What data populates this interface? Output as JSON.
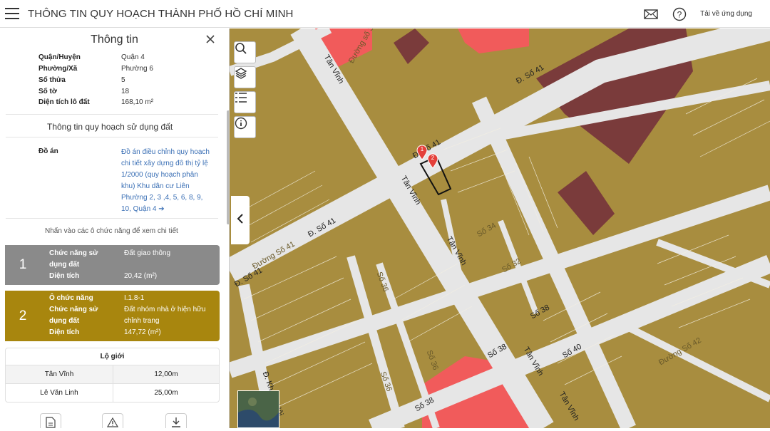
{
  "app": {
    "title": "THÔNG TIN QUY HOẠCH THÀNH PHỐ HỒ CHÍ MINH",
    "download_label": "Tải về ứng dụng"
  },
  "panel": {
    "title": "Thông tin",
    "parcel": [
      {
        "key": "Quận/Huyện",
        "value": "Quận 4"
      },
      {
        "key": "Phường/Xã",
        "value": "Phường 6"
      },
      {
        "key": "Số thửa",
        "value": "5"
      },
      {
        "key": "Số tờ",
        "value": "18"
      },
      {
        "key": "Diện tích lô đất",
        "value": "168,10 m²"
      }
    ],
    "section_title": "Thông tin quy hoạch sử dụng đất",
    "doan": {
      "key": "Đồ án",
      "value": "Đồ án điều chỉnh quy hoạch chi tiết xây dựng đô thị tỷ lệ 1/2000 (quy hoạch phân khu) Khu dân cư Liên Phường 2, 3 ,4, 5, 6, 8, 9, 10, Quận 4 ➔"
    },
    "hint": "Nhấn vào các ô chức năng để xem chi tiết",
    "cards": [
      {
        "number": "1",
        "color": "#8a8a8a",
        "rows": [
          {
            "key": "Chức năng sử dụng đất",
            "value": "Đất giao thông"
          },
          {
            "key": "Diện tích",
            "value": "20,42 (m²)"
          }
        ]
      },
      {
        "number": "2",
        "color": "#a8860e",
        "rows": [
          {
            "key": "Ô chức năng",
            "value": "I.1.8-1"
          },
          {
            "key": "Chức năng sử dụng đất",
            "value": "Đất nhóm nhà ở hiện hữu chỉnh trang"
          },
          {
            "key": "Diện tích",
            "value": "147,72 (m²)"
          }
        ]
      }
    ],
    "lo_gioi": {
      "title": "Lộ giới",
      "rows": [
        {
          "street": "Tân Vĩnh",
          "width": "12,00m"
        },
        {
          "street": "Lê Văn Linh",
          "width": "25,00m"
        }
      ]
    }
  },
  "map": {
    "streets": [
      "Tân Vĩnh",
      "Đ. Số 41",
      "Đ. Số 41",
      "Đ. Số 41",
      "Tân Vĩnh",
      "Tân Vĩnh",
      "Tân Vĩnh",
      "Số 38",
      "Số 38",
      "Số 38",
      "Số 40",
      "Đ. Số 41",
      "Đường số 32",
      "Số 34",
      "Số 36",
      "Số 32",
      "Số 36",
      "Đ. Khánh Hội",
      "Số 36",
      "Đường Số 41",
      "Tân Vĩnh",
      "Đường Số 42"
    ],
    "markers": [
      "1",
      "2"
    ],
    "colors": {
      "residential": "#a88d3f",
      "road": "#e6e6e6",
      "commercial": "#f15b5b",
      "public": "#7a3b3b"
    }
  }
}
